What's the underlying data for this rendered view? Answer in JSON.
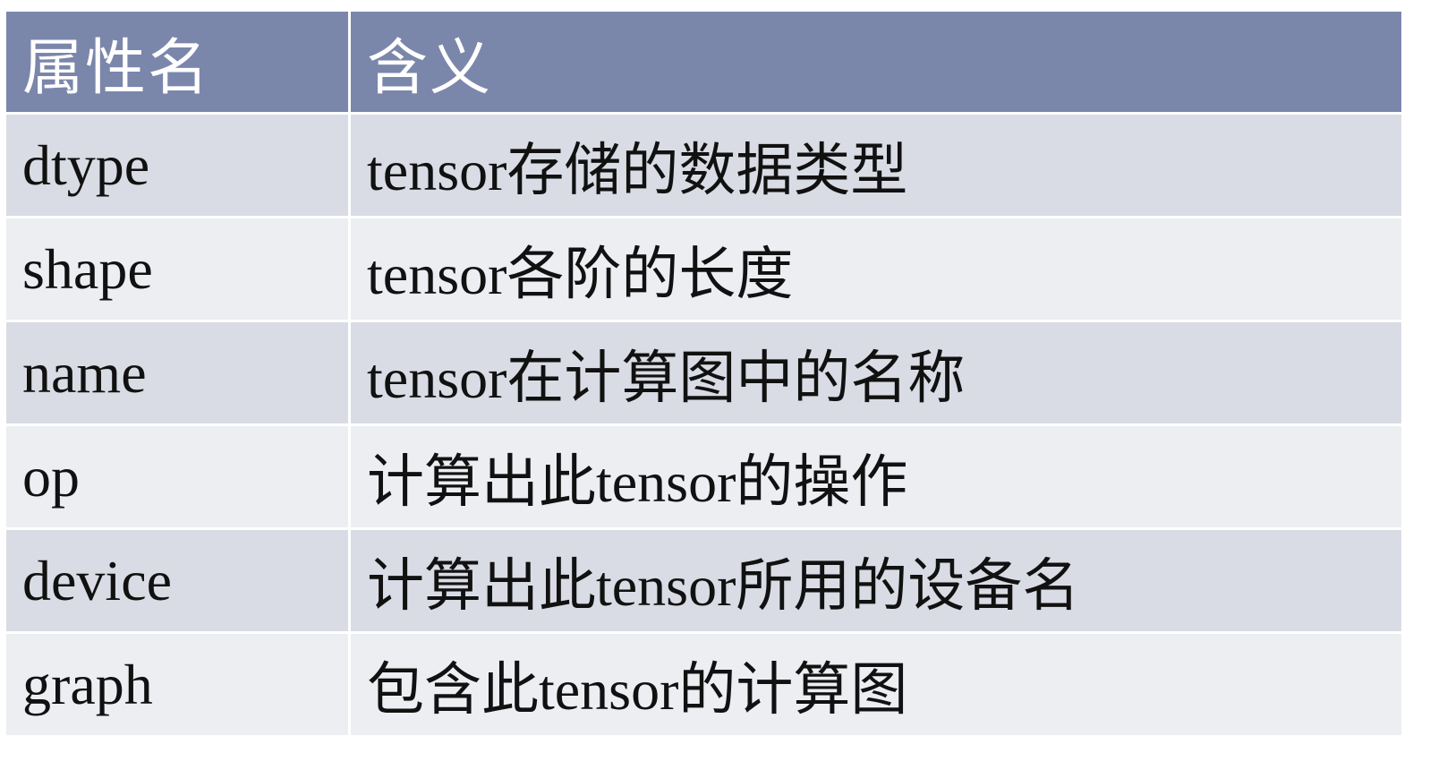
{
  "table": {
    "headers": [
      "属性名",
      "含义"
    ],
    "rows": [
      {
        "attr": "dtype",
        "meaning": "tensor存储的数据类型"
      },
      {
        "attr": "shape",
        "meaning": "tensor各阶的长度"
      },
      {
        "attr": "name",
        "meaning": "tensor在计算图中的名称"
      },
      {
        "attr": "op",
        "meaning": "计算出此tensor的操作"
      },
      {
        "attr": "device",
        "meaning": "计算出此tensor所用的设备名"
      },
      {
        "attr": "graph",
        "meaning": "包含此tensor的计算图"
      }
    ]
  },
  "colors": {
    "header_bg": "#7b86ab",
    "row_odd_bg": "#d9dce4",
    "row_even_bg": "#eceef2"
  }
}
